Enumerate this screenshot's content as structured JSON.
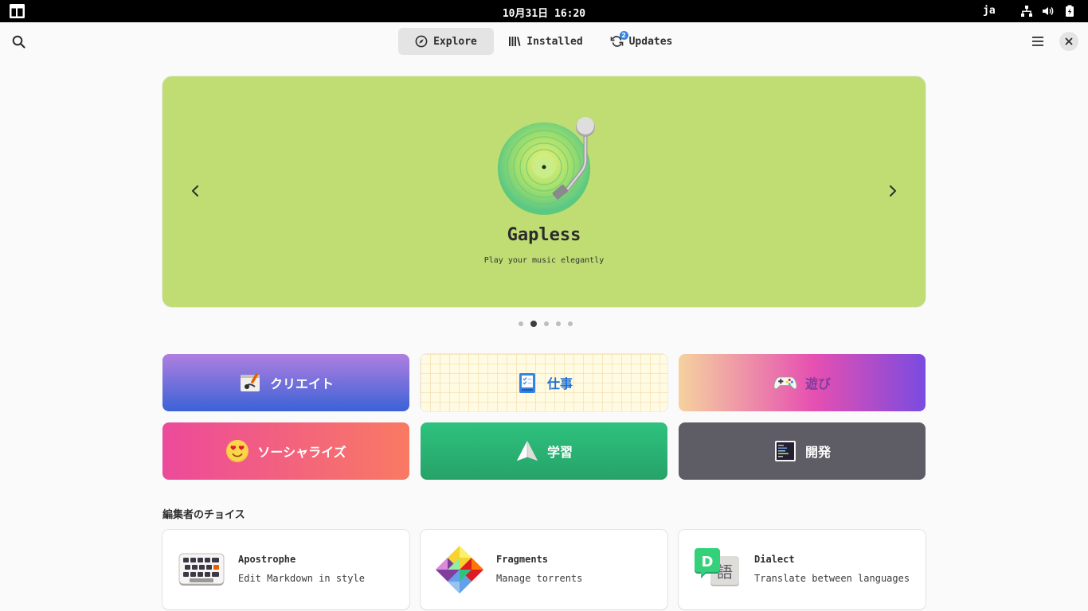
{
  "system_bar": {
    "clock": "10月31日  16:20",
    "language": "ja",
    "icons": [
      "network-icon",
      "volume-icon",
      "battery-icon"
    ]
  },
  "header": {
    "tabs": [
      {
        "label": "Explore",
        "icon": "compass-icon",
        "active": true
      },
      {
        "label": "Installed",
        "icon": "library-icon",
        "active": false
      },
      {
        "label": "Updates",
        "icon": "refresh-icon",
        "active": false,
        "badge": "2"
      }
    ]
  },
  "carousel": {
    "title": "Gapless",
    "subtitle": "Play your music elegantly",
    "background": "#bfdd73",
    "slide_count": 5,
    "active_slide": 2
  },
  "categories": [
    {
      "label": "クリエイト",
      "icon": "create-icon",
      "colors": [
        "#b07fe0",
        "#3a62d6"
      ],
      "text_color": "#ffffff"
    },
    {
      "label": "仕事",
      "icon": "work-icon",
      "colors": [
        "#fffbe3"
      ],
      "text_color": "#1c71d8"
    },
    {
      "label": "遊び",
      "icon": "gamepad-icon",
      "colors": [
        "#f5d29f",
        "#e64fb1",
        "#7a4be0"
      ],
      "text_color": "#813d9c"
    },
    {
      "label": "ソーシャライズ",
      "icon": "heart-eyes-icon",
      "colors": [
        "#ec4a9a",
        "#f97a63"
      ],
      "text_color": "#ffffff"
    },
    {
      "label": "学習",
      "icon": "paper-plane-icon",
      "colors": [
        "#2ec27e",
        "#26a269"
      ],
      "text_color": "#ffffff"
    },
    {
      "label": "開発",
      "icon": "terminal-icon",
      "colors": [
        "#5e5c64"
      ],
      "text_color": "#ffffff"
    }
  ],
  "editors_choice": {
    "title": "編集者のチョイス",
    "apps": [
      {
        "name": "Apostrophe",
        "description": "Edit Markdown in style",
        "icon": "keyboard-icon"
      },
      {
        "name": "Fragments",
        "description": "Manage torrents",
        "icon": "fragments-icon"
      },
      {
        "name": "Dialect",
        "description": "Translate between languages",
        "icon": "dialect-icon"
      }
    ]
  }
}
